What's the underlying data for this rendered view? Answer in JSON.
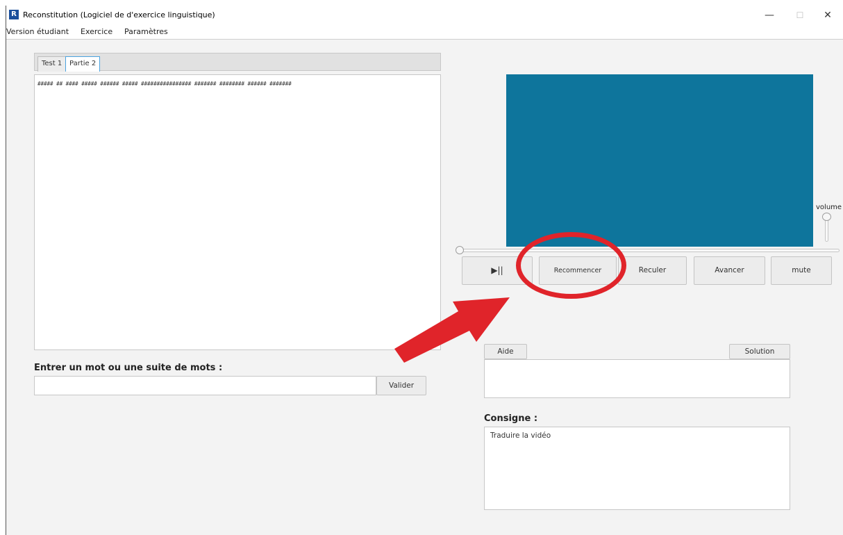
{
  "window": {
    "title": "Reconstitution (Logiciel de d'exercice linguistique)",
    "icon_letter": "R",
    "controls": {
      "minimize": "—",
      "maximize": "☐",
      "close": "✕"
    }
  },
  "menu": {
    "items": [
      "Version étudiant",
      "Exercice",
      "Paramètres"
    ]
  },
  "tabs": [
    "Test 1",
    "Partie 2"
  ],
  "active_tab": "Partie 2",
  "exercise_text": "##### ## #### ##### ###### ##### ################ ####### ######## ###### #######",
  "entry": {
    "label": "Entrer un mot ou une suite de mots :",
    "value": "",
    "validate_label": "Valider"
  },
  "player": {
    "video_color": "#0e759c",
    "volume_label": "volume",
    "play_pause_label": "▶||",
    "restart_label": "Recommencer",
    "back_label": "Reculer",
    "forward_label": "Avancer",
    "mute_label": "mute",
    "progress_fraction": 0
  },
  "help": {
    "aide_label": "Aide",
    "solution_label": "Solution",
    "content": ""
  },
  "consigne": {
    "label": "Consigne :",
    "text": "Traduire la vidéo"
  },
  "annotation": {
    "color": "#e0242a"
  }
}
